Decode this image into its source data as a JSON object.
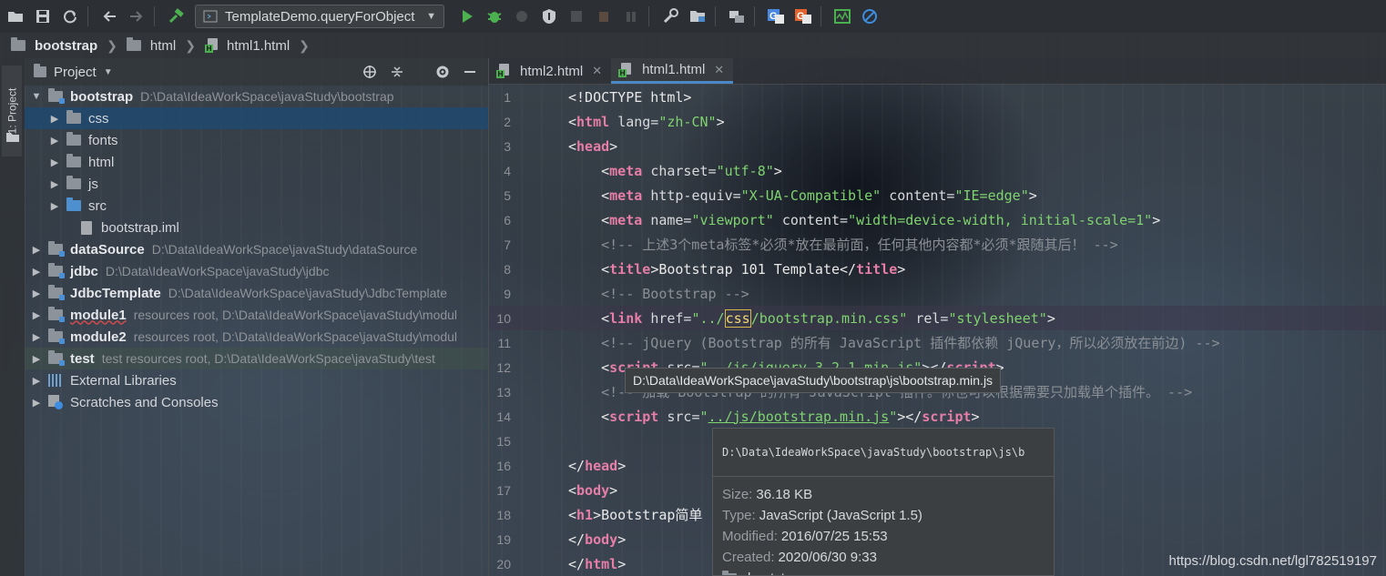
{
  "toolbar": {
    "run_config": "TemplateDemo.queryForObject"
  },
  "breadcrumb": [
    "bootstrap",
    "html",
    "html1.html"
  ],
  "left_stripe": {
    "project_tab": "1: Project"
  },
  "project_panel": {
    "title": "Project",
    "tree": [
      {
        "name": "bootstrap",
        "path": "D:\\Data\\IdeaWorkSpace\\javaStudy\\bootstrap",
        "level": 0,
        "expanded": true,
        "bold": true
      },
      {
        "name": "css",
        "level": 1
      },
      {
        "name": "fonts",
        "level": 1
      },
      {
        "name": "html",
        "level": 1
      },
      {
        "name": "js",
        "level": 1
      },
      {
        "name": "src",
        "level": 1
      },
      {
        "name": "bootstrap.iml",
        "level": 1
      },
      {
        "name": "dataSource",
        "path": "D:\\Data\\IdeaWorkSpace\\javaStudy\\dataSource",
        "level": 0,
        "bold": true
      },
      {
        "name": "jdbc",
        "path": "D:\\Data\\IdeaWorkSpace\\javaStudy\\jdbc",
        "level": 0,
        "bold": true
      },
      {
        "name": "JdbcTemplate",
        "path": "D:\\Data\\IdeaWorkSpace\\javaStudy\\JdbcTemplate",
        "level": 0,
        "bold": true
      },
      {
        "name": "module1",
        "path": "resources root,  D:\\Data\\IdeaWorkSpace\\javaStudy\\modul",
        "level": 0,
        "bold": true
      },
      {
        "name": "module2",
        "path": "resources root,  D:\\Data\\IdeaWorkSpace\\javaStudy\\modul",
        "level": 0,
        "bold": true
      },
      {
        "name": "test",
        "path": "test resources root,  D:\\Data\\IdeaWorkSpace\\javaStudy\\test",
        "level": 0,
        "bold": true
      },
      {
        "name": "External Libraries",
        "level": 0
      },
      {
        "name": "Scratches and Consoles",
        "level": 0
      }
    ]
  },
  "editor": {
    "tabs": [
      {
        "label": "html2.html",
        "active": false
      },
      {
        "label": "html1.html",
        "active": true
      }
    ],
    "line_numbers": [
      "1",
      "2",
      "3",
      "4",
      "5",
      "6",
      "7",
      "8",
      "9",
      "10",
      "11",
      "12",
      "13",
      "14",
      "15",
      "16",
      "17",
      "18",
      "19",
      "20"
    ],
    "current_line": "10"
  },
  "path_tooltip": "D:\\Data\\IdeaWorkSpace\\javaStudy\\bootstrap\\js\\bootstrap.min.js",
  "quick_doc": {
    "header": "D:\\Data\\IdeaWorkSpace\\javaStudy\\bootstrap\\js\\b",
    "size_label": "Size:",
    "size": "36.18 KB",
    "type_label": "Type:",
    "type": "JavaScript (JavaScript 1.5)",
    "modified_label": "Modified:",
    "modified": "2016/07/25 15:53",
    "created_label": "Created:",
    "created": "2020/06/30 9:33",
    "folder": "bootstrap"
  },
  "watermark": "https://blog.csdn.net/lgl782519197"
}
